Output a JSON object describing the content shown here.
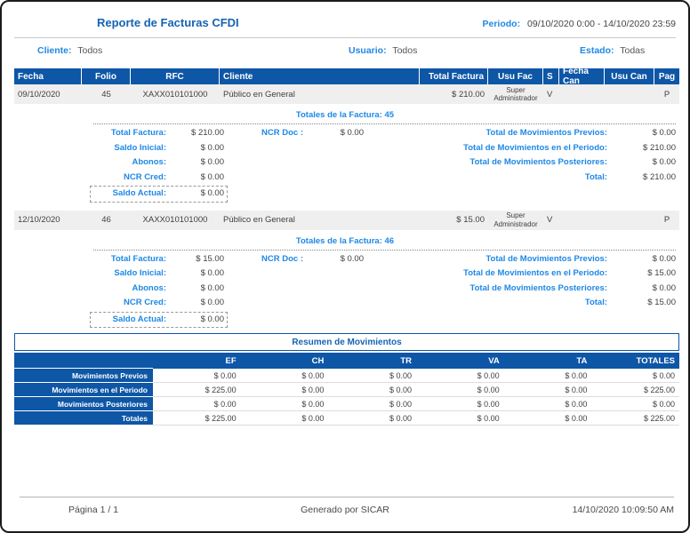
{
  "report": {
    "title": "Reporte de Facturas CFDI",
    "period_label": "Periodo:",
    "period_value": "09/10/2020 0:00  -  14/10/2020 23:59"
  },
  "filters": {
    "cliente_label": "Cliente:",
    "cliente_value": "Todos",
    "usuario_label": "Usuario:",
    "usuario_value": "Todos",
    "estado_label": "Estado:",
    "estado_value": "Todas"
  },
  "invoice_table": {
    "columns": [
      "Fecha",
      "Folio",
      "RFC",
      "Cliente",
      "Total Factura",
      "Usu Fac",
      "S",
      "Fecha Can",
      "Usu Can",
      "Pag"
    ]
  },
  "invoices": [
    {
      "fecha": "09/10/2020",
      "folio": "45",
      "rfc": "XAXX010101000",
      "cliente": "Público en General",
      "total_factura": "$ 210.00",
      "usu_fac": "Super Administrador",
      "s": "V",
      "fecha_can": "",
      "usu_can": "",
      "pag": "P",
      "totals_heading": "Totales de la Factura: 45",
      "detail_left": [
        {
          "label": "Total Factura:",
          "value": "$ 210.00"
        },
        {
          "label": "Saldo Inicial:",
          "value": "$ 0.00"
        },
        {
          "label": "Abonos:",
          "value": "$ 0.00"
        },
        {
          "label": "NCR Cred:",
          "value": "$ 0.00"
        },
        {
          "label": "Saldo Actual:",
          "value": "$ 0.00"
        }
      ],
      "detail_mid": [
        {
          "label": "NCR Doc :",
          "value": "$ 0.00"
        }
      ],
      "detail_right": [
        {
          "label": "Total de Movimientos Previos:",
          "value": "$ 0.00"
        },
        {
          "label": "Total de Movimientos en el Periodo:",
          "value": "$ 210.00"
        },
        {
          "label": "Total de Movimientos Posteriores:",
          "value": "$ 0.00"
        },
        {
          "label": "Total:",
          "value": "$ 210.00"
        }
      ]
    },
    {
      "fecha": "12/10/2020",
      "folio": "46",
      "rfc": "XAXX010101000",
      "cliente": "Público en General",
      "total_factura": "$ 15.00",
      "usu_fac": "Super Administrador",
      "s": "V",
      "fecha_can": "",
      "usu_can": "",
      "pag": "P",
      "totals_heading": "Totales de la Factura: 46",
      "detail_left": [
        {
          "label": "Total Factura:",
          "value": "$ 15.00"
        },
        {
          "label": "Saldo Inicial:",
          "value": "$ 0.00"
        },
        {
          "label": "Abonos:",
          "value": "$ 0.00"
        },
        {
          "label": "NCR Cred:",
          "value": "$ 0.00"
        },
        {
          "label": "Saldo Actual:",
          "value": "$ 0.00"
        }
      ],
      "detail_mid": [
        {
          "label": "NCR Doc :",
          "value": "$ 0.00"
        }
      ],
      "detail_right": [
        {
          "label": "Total de Movimientos Previos:",
          "value": "$ 0.00"
        },
        {
          "label": "Total de Movimientos en el Periodo:",
          "value": "$ 15.00"
        },
        {
          "label": "Total de Movimientos Posteriores:",
          "value": "$ 0.00"
        },
        {
          "label": "Total:",
          "value": "$ 15.00"
        }
      ]
    }
  ],
  "summary": {
    "title": "Resumen de Movimientos",
    "columns": [
      "EF",
      "CH",
      "TR",
      "VA",
      "TA",
      "TOTALES"
    ],
    "rows": [
      {
        "label": "Movimientos Previos",
        "values": [
          "$ 0.00",
          "$ 0.00",
          "$ 0.00",
          "$ 0.00",
          "$ 0.00",
          "$ 0.00"
        ]
      },
      {
        "label": "Movimientos en el Periodo",
        "values": [
          "$ 225.00",
          "$ 0.00",
          "$ 0.00",
          "$ 0.00",
          "$ 0.00",
          "$ 225.00"
        ]
      },
      {
        "label": "Movimientos Posteriores",
        "values": [
          "$ 0.00",
          "$ 0.00",
          "$ 0.00",
          "$ 0.00",
          "$ 0.00",
          "$ 0.00"
        ]
      },
      {
        "label": "Totales",
        "values": [
          "$ 225.00",
          "$ 0.00",
          "$ 0.00",
          "$ 0.00",
          "$ 0.00",
          "$ 225.00"
        ]
      }
    ]
  },
  "footer": {
    "page": "Página 1 / 1",
    "generated": "Generado por SICAR",
    "timestamp": "14/10/2020 10:09:50 AM"
  },
  "colors": {
    "table_header_bg": "#0E56A6",
    "accent_blue": "#1E88E5",
    "title_blue": "#1464B4",
    "row_bg": "#EFEFEF",
    "text": "#3F3F3F"
  }
}
